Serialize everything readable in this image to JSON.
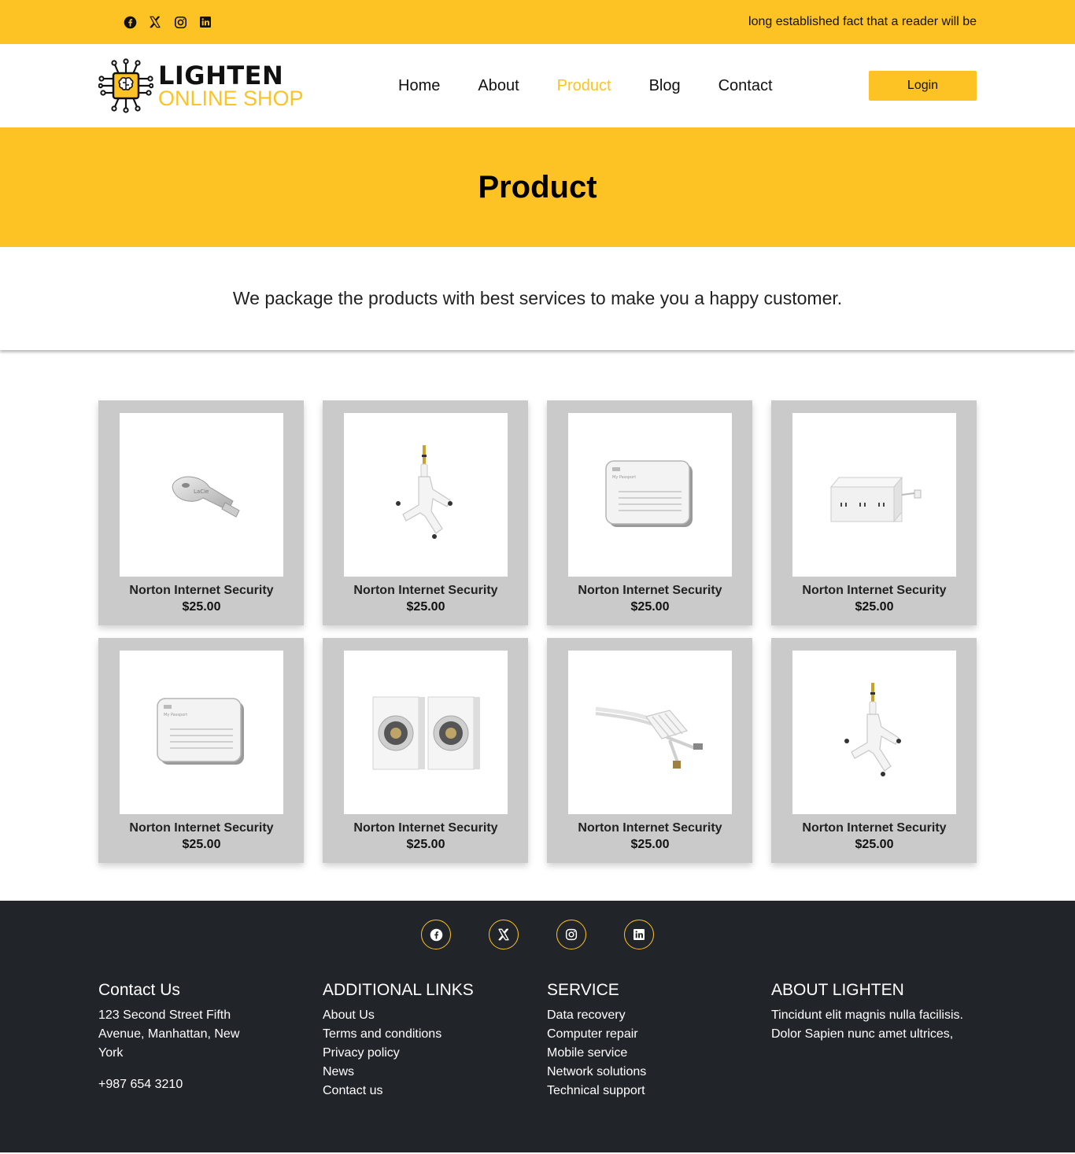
{
  "topbar": {
    "socials": [
      "facebook-icon",
      "x-icon",
      "instagram-icon",
      "linkedin-icon"
    ],
    "tagline": "long established fact that a reader will be"
  },
  "header": {
    "logo_line1": "LIGHTEN",
    "logo_line2": "ONLINE SHOP",
    "nav": [
      {
        "label": "Home",
        "active": false
      },
      {
        "label": "About",
        "active": false
      },
      {
        "label": "Product",
        "active": true
      },
      {
        "label": "Blog",
        "active": false
      },
      {
        "label": "Contact",
        "active": false
      }
    ],
    "login_label": "Login"
  },
  "banner": {
    "title": "Product"
  },
  "intro": {
    "text": "We package the products with best services to make you a happy customer."
  },
  "products": [
    {
      "name": "Norton Internet Security",
      "price": "$25.00",
      "image": "usb-key"
    },
    {
      "name": "Norton Internet Security",
      "price": "$25.00",
      "image": "audio-splitter"
    },
    {
      "name": "Norton Internet Security",
      "price": "$25.00",
      "image": "hard-drive"
    },
    {
      "name": "Norton Internet Security",
      "price": "$25.00",
      "image": "power-strip"
    },
    {
      "name": "Norton Internet Security",
      "price": "$25.00",
      "image": "hard-drive"
    },
    {
      "name": "Norton Internet Security",
      "price": "$25.00",
      "image": "speakers"
    },
    {
      "name": "Norton Internet Security",
      "price": "$25.00",
      "image": "cable-organizer"
    },
    {
      "name": "Norton Internet Security",
      "price": "$25.00",
      "image": "audio-splitter"
    }
  ],
  "footer": {
    "socials": [
      "facebook-icon",
      "x-icon",
      "instagram-icon",
      "linkedin-icon"
    ],
    "contact": {
      "title": "Contact Us",
      "address": "123 Second Street Fifth Avenue, Manhattan, New York",
      "phone": "+987 654 3210"
    },
    "links": {
      "title": "ADDITIONAL LINKS",
      "items": [
        "About Us",
        "Terms and conditions",
        "Privacy policy",
        "News",
        "Contact us"
      ]
    },
    "service": {
      "title": "SERVICE",
      "items": [
        "Data recovery",
        "Computer repair",
        "Mobile service",
        "Network solutions",
        "Technical support"
      ]
    },
    "about": {
      "title": "ABOUT LIGHTEN",
      "text": "Tincidunt elit magnis nulla facilisis. Dolor Sapien nunc amet ultrices,"
    }
  },
  "colors": {
    "accent": "#fdc223",
    "footer_bg": "#212429",
    "card_bg": "#cacaca"
  }
}
